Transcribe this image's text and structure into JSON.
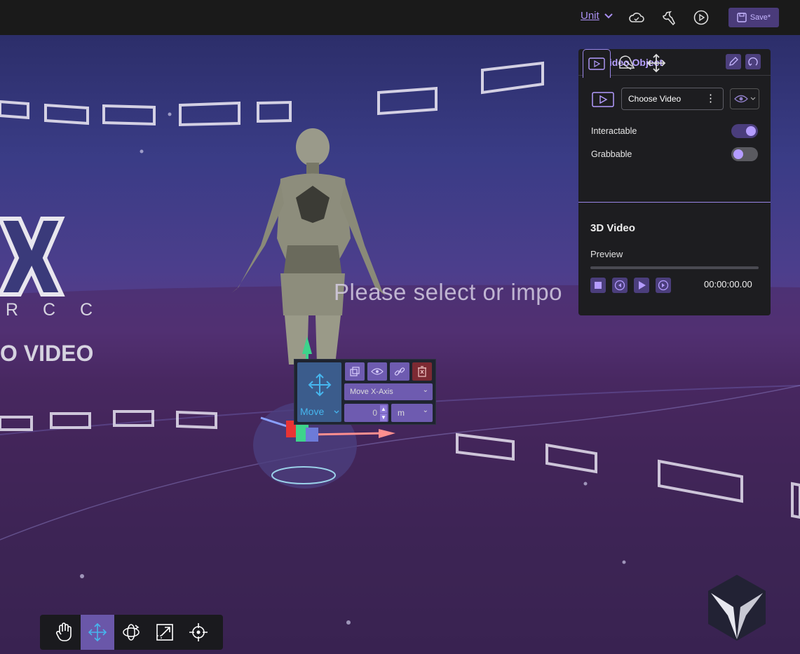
{
  "topbar": {
    "unit_label": "Unit",
    "save_label": "Save*",
    "icons": [
      "cloud-icon",
      "wrench-icon",
      "play-circle-icon",
      "save-icon"
    ],
    "marker": "x"
  },
  "scene": {
    "logo_letters": "R C C",
    "overlay_text": "Please select or impo",
    "video_text": "O VIDEO"
  },
  "panel": {
    "title": "3D Video Object",
    "choose_video": "Choose Video",
    "interactable_label": "Interactable",
    "interactable_on": true,
    "grabbable_label": "Grabbable",
    "grabbable_on": false,
    "section_title": "3D Video",
    "preview_label": "Preview",
    "time": "00:00:00.00",
    "progress": 0
  },
  "move_widget": {
    "mode_label": "Move",
    "axis_label": "Move X-Axis",
    "value": "0",
    "unit": "m"
  },
  "toolbar": {
    "tools": [
      "hand-tool",
      "move-tool",
      "rotate-tool",
      "scale-tool",
      "pivot-tool"
    ],
    "active_tool": "move-tool"
  },
  "colors": {
    "accent": "#b49cff",
    "button": "#4b3e7c",
    "panel_bg": "#1d1d20",
    "move_blue": "#46b6ee",
    "delete_red": "#7c2a33"
  }
}
